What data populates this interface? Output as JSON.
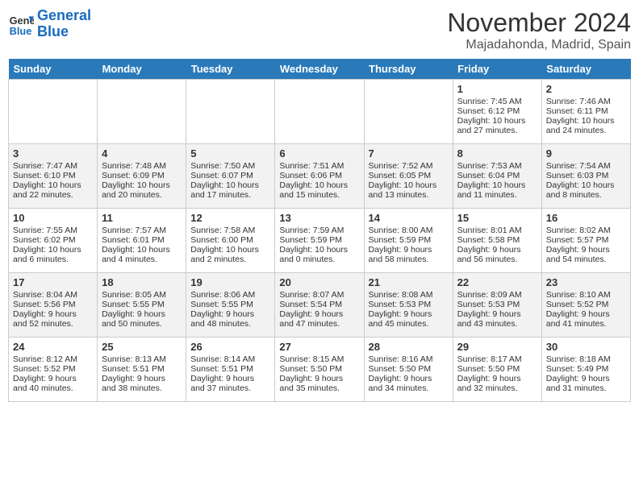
{
  "header": {
    "logo_line1": "General",
    "logo_line2": "Blue",
    "month": "November 2024",
    "location": "Majadahonda, Madrid, Spain"
  },
  "days_of_week": [
    "Sunday",
    "Monday",
    "Tuesday",
    "Wednesday",
    "Thursday",
    "Friday",
    "Saturday"
  ],
  "weeks": [
    [
      {
        "day": "",
        "empty": true
      },
      {
        "day": "",
        "empty": true
      },
      {
        "day": "",
        "empty": true
      },
      {
        "day": "",
        "empty": true
      },
      {
        "day": "",
        "empty": true
      },
      {
        "day": "1",
        "sunrise": "Sunrise: 7:45 AM",
        "sunset": "Sunset: 6:12 PM",
        "daylight": "Daylight: 10 hours and 27 minutes."
      },
      {
        "day": "2",
        "sunrise": "Sunrise: 7:46 AM",
        "sunset": "Sunset: 6:11 PM",
        "daylight": "Daylight: 10 hours and 24 minutes."
      }
    ],
    [
      {
        "day": "3",
        "sunrise": "Sunrise: 7:47 AM",
        "sunset": "Sunset: 6:10 PM",
        "daylight": "Daylight: 10 hours and 22 minutes."
      },
      {
        "day": "4",
        "sunrise": "Sunrise: 7:48 AM",
        "sunset": "Sunset: 6:09 PM",
        "daylight": "Daylight: 10 hours and 20 minutes."
      },
      {
        "day": "5",
        "sunrise": "Sunrise: 7:50 AM",
        "sunset": "Sunset: 6:07 PM",
        "daylight": "Daylight: 10 hours and 17 minutes."
      },
      {
        "day": "6",
        "sunrise": "Sunrise: 7:51 AM",
        "sunset": "Sunset: 6:06 PM",
        "daylight": "Daylight: 10 hours and 15 minutes."
      },
      {
        "day": "7",
        "sunrise": "Sunrise: 7:52 AM",
        "sunset": "Sunset: 6:05 PM",
        "daylight": "Daylight: 10 hours and 13 minutes."
      },
      {
        "day": "8",
        "sunrise": "Sunrise: 7:53 AM",
        "sunset": "Sunset: 6:04 PM",
        "daylight": "Daylight: 10 hours and 11 minutes."
      },
      {
        "day": "9",
        "sunrise": "Sunrise: 7:54 AM",
        "sunset": "Sunset: 6:03 PM",
        "daylight": "Daylight: 10 hours and 8 minutes."
      }
    ],
    [
      {
        "day": "10",
        "sunrise": "Sunrise: 7:55 AM",
        "sunset": "Sunset: 6:02 PM",
        "daylight": "Daylight: 10 hours and 6 minutes."
      },
      {
        "day": "11",
        "sunrise": "Sunrise: 7:57 AM",
        "sunset": "Sunset: 6:01 PM",
        "daylight": "Daylight: 10 hours and 4 minutes."
      },
      {
        "day": "12",
        "sunrise": "Sunrise: 7:58 AM",
        "sunset": "Sunset: 6:00 PM",
        "daylight": "Daylight: 10 hours and 2 minutes."
      },
      {
        "day": "13",
        "sunrise": "Sunrise: 7:59 AM",
        "sunset": "Sunset: 5:59 PM",
        "daylight": "Daylight: 10 hours and 0 minutes."
      },
      {
        "day": "14",
        "sunrise": "Sunrise: 8:00 AM",
        "sunset": "Sunset: 5:59 PM",
        "daylight": "Daylight: 9 hours and 58 minutes."
      },
      {
        "day": "15",
        "sunrise": "Sunrise: 8:01 AM",
        "sunset": "Sunset: 5:58 PM",
        "daylight": "Daylight: 9 hours and 56 minutes."
      },
      {
        "day": "16",
        "sunrise": "Sunrise: 8:02 AM",
        "sunset": "Sunset: 5:57 PM",
        "daylight": "Daylight: 9 hours and 54 minutes."
      }
    ],
    [
      {
        "day": "17",
        "sunrise": "Sunrise: 8:04 AM",
        "sunset": "Sunset: 5:56 PM",
        "daylight": "Daylight: 9 hours and 52 minutes."
      },
      {
        "day": "18",
        "sunrise": "Sunrise: 8:05 AM",
        "sunset": "Sunset: 5:55 PM",
        "daylight": "Daylight: 9 hours and 50 minutes."
      },
      {
        "day": "19",
        "sunrise": "Sunrise: 8:06 AM",
        "sunset": "Sunset: 5:55 PM",
        "daylight": "Daylight: 9 hours and 48 minutes."
      },
      {
        "day": "20",
        "sunrise": "Sunrise: 8:07 AM",
        "sunset": "Sunset: 5:54 PM",
        "daylight": "Daylight: 9 hours and 47 minutes."
      },
      {
        "day": "21",
        "sunrise": "Sunrise: 8:08 AM",
        "sunset": "Sunset: 5:53 PM",
        "daylight": "Daylight: 9 hours and 45 minutes."
      },
      {
        "day": "22",
        "sunrise": "Sunrise: 8:09 AM",
        "sunset": "Sunset: 5:53 PM",
        "daylight": "Daylight: 9 hours and 43 minutes."
      },
      {
        "day": "23",
        "sunrise": "Sunrise: 8:10 AM",
        "sunset": "Sunset: 5:52 PM",
        "daylight": "Daylight: 9 hours and 41 minutes."
      }
    ],
    [
      {
        "day": "24",
        "sunrise": "Sunrise: 8:12 AM",
        "sunset": "Sunset: 5:52 PM",
        "daylight": "Daylight: 9 hours and 40 minutes."
      },
      {
        "day": "25",
        "sunrise": "Sunrise: 8:13 AM",
        "sunset": "Sunset: 5:51 PM",
        "daylight": "Daylight: 9 hours and 38 minutes."
      },
      {
        "day": "26",
        "sunrise": "Sunrise: 8:14 AM",
        "sunset": "Sunset: 5:51 PM",
        "daylight": "Daylight: 9 hours and 37 minutes."
      },
      {
        "day": "27",
        "sunrise": "Sunrise: 8:15 AM",
        "sunset": "Sunset: 5:50 PM",
        "daylight": "Daylight: 9 hours and 35 minutes."
      },
      {
        "day": "28",
        "sunrise": "Sunrise: 8:16 AM",
        "sunset": "Sunset: 5:50 PM",
        "daylight": "Daylight: 9 hours and 34 minutes."
      },
      {
        "day": "29",
        "sunrise": "Sunrise: 8:17 AM",
        "sunset": "Sunset: 5:50 PM",
        "daylight": "Daylight: 9 hours and 32 minutes."
      },
      {
        "day": "30",
        "sunrise": "Sunrise: 8:18 AM",
        "sunset": "Sunset: 5:49 PM",
        "daylight": "Daylight: 9 hours and 31 minutes."
      }
    ]
  ]
}
